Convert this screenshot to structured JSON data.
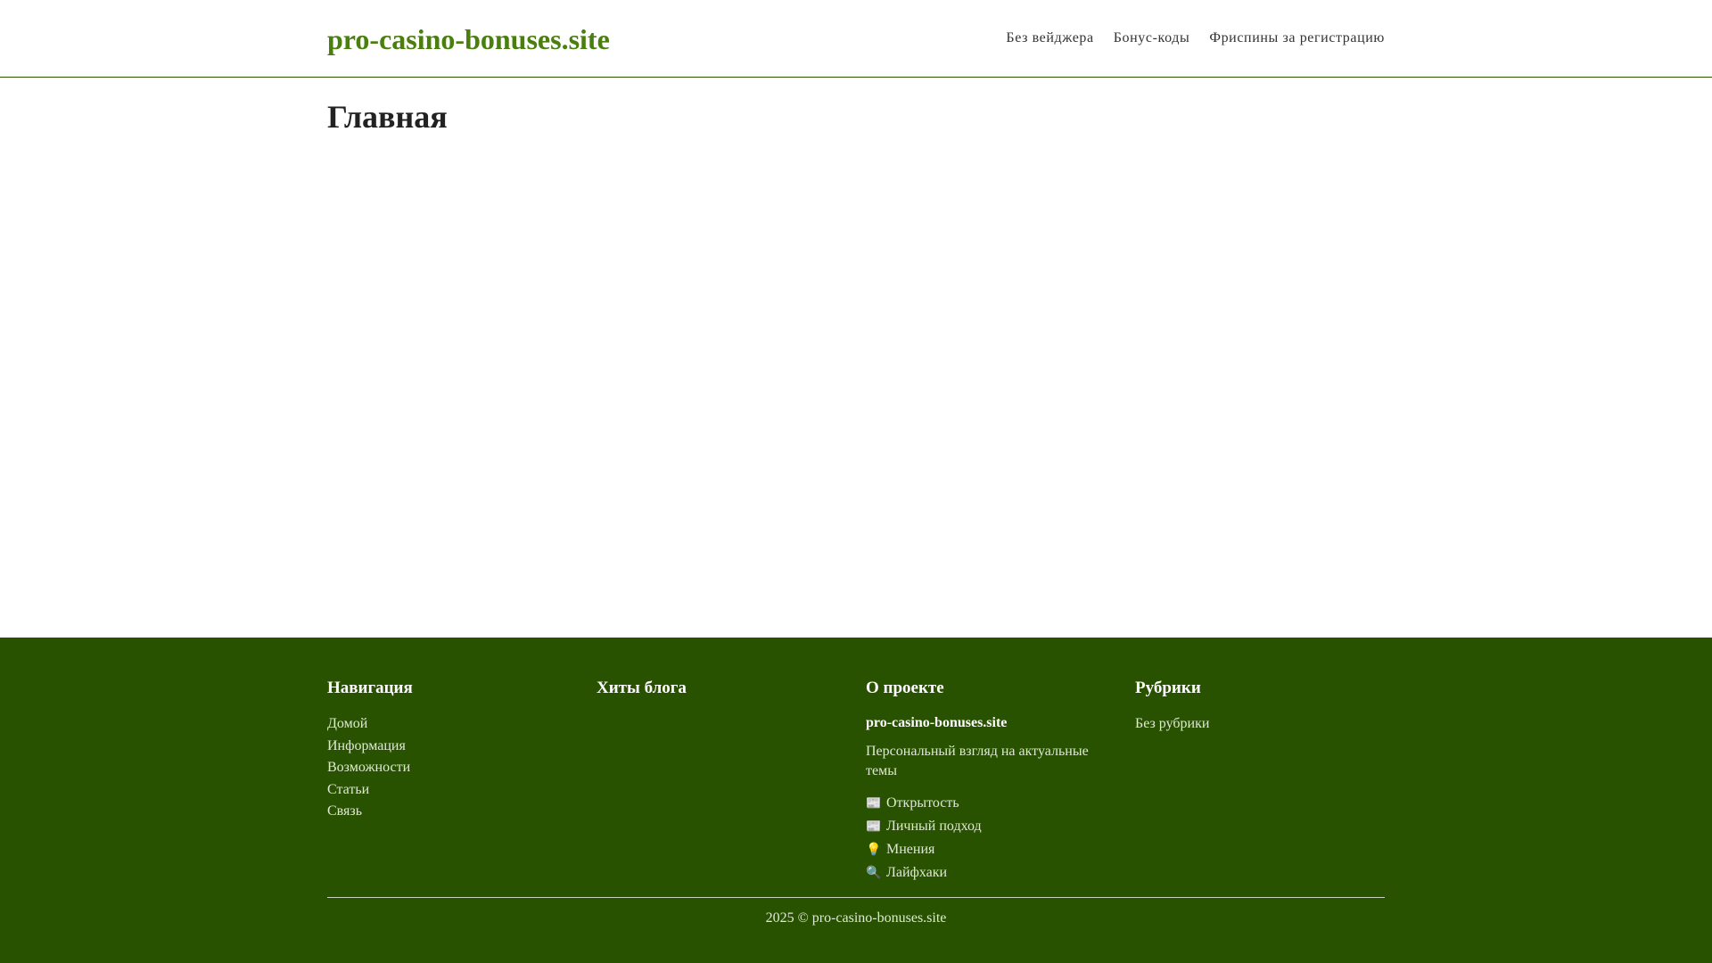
{
  "header": {
    "logo": "pro-casino-bonuses.site",
    "nav": [
      {
        "label": "Без вейджера"
      },
      {
        "label": "Бонус-коды"
      },
      {
        "label": "Фриспины за регистрацию"
      }
    ]
  },
  "main": {
    "title": "Главная"
  },
  "footer": {
    "navigation": {
      "heading": "Навигация",
      "links": [
        "Домой",
        "Информация",
        "Возможности",
        "Статьи",
        "Связь"
      ]
    },
    "hits": {
      "heading": "Хиты блога"
    },
    "about": {
      "heading": "О проекте",
      "site_name": "pro-casino-bonuses.site",
      "description": "Персональный взгляд на актуальные темы",
      "features": [
        {
          "icon": "newspaper-icon",
          "glyph": "📰",
          "label": "Открытость"
        },
        {
          "icon": "newspaper-icon",
          "glyph": "📰",
          "label": "Личный подход"
        },
        {
          "icon": "light-bulb-icon",
          "glyph": "💡",
          "label": "Мнения"
        },
        {
          "icon": "magnifier-icon",
          "glyph": "🔍",
          "label": "Лайфхаки"
        }
      ]
    },
    "rubrics": {
      "heading": "Рубрики",
      "links": [
        "Без рубрики"
      ]
    },
    "copyright": "2025 © pro-casino-bonuses.site"
  },
  "colors": {
    "brand_green": "#4a7f0e",
    "footer_bg": "#285200",
    "text_dark": "#333333"
  }
}
